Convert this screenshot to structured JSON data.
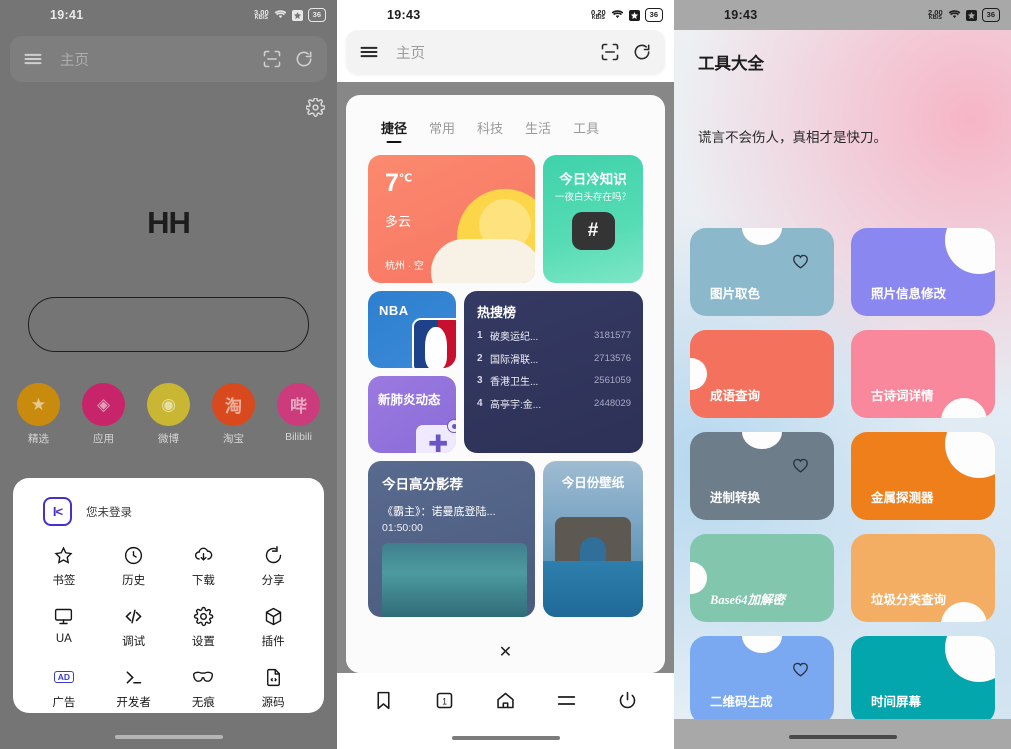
{
  "panel1": {
    "status": {
      "time": "19:41",
      "net_speed": "3.00",
      "net_unit": "KB/S",
      "battery": "36"
    },
    "omnibox": {
      "title": "主页",
      "scan_icon": "scan-icon",
      "reload_icon": "reload-icon",
      "menu_icon": "hamburger-icon"
    },
    "logo": "HH",
    "search_placeholder": "",
    "quick_links": [
      {
        "label": "精选",
        "glyph": "★",
        "color": "#c98b0e"
      },
      {
        "label": "应用",
        "glyph": "◈",
        "color": "#c7246a"
      },
      {
        "label": "微博",
        "glyph": "◉",
        "color": "#c9b734"
      },
      {
        "label": "淘宝",
        "glyph": "淘",
        "color": "#d84a1e"
      },
      {
        "label": "Bilibili",
        "glyph": "哔",
        "color": "#cc3c7c"
      }
    ],
    "sheet": {
      "account_badge": "I<",
      "account_text": "您未登录",
      "items": [
        {
          "label": "书签",
          "icon": "star-icon"
        },
        {
          "label": "历史",
          "icon": "clock-icon"
        },
        {
          "label": "下载",
          "icon": "download-cloud-icon"
        },
        {
          "label": "分享",
          "icon": "share-refresh-icon"
        },
        {
          "label": "UA",
          "icon": "monitor-icon"
        },
        {
          "label": "调试",
          "icon": "code-icon"
        },
        {
          "label": "设置",
          "icon": "gear-icon"
        },
        {
          "label": "插件",
          "icon": "cube-icon"
        },
        {
          "label": "广告",
          "icon": "ad-icon",
          "badge": "AD"
        },
        {
          "label": "开发者",
          "icon": "terminal-icon"
        },
        {
          "label": "无痕",
          "icon": "incognito-mask-icon"
        },
        {
          "label": "源码",
          "icon": "source-file-icon"
        }
      ]
    }
  },
  "panel2": {
    "status": {
      "time": "19:43",
      "net_speed": "0.20",
      "net_unit": "KB/S",
      "battery": "36"
    },
    "omnibox": {
      "title": "主页"
    },
    "tabs": [
      {
        "label": "捷径",
        "active": true
      },
      {
        "label": "常用",
        "active": false
      },
      {
        "label": "科技",
        "active": false
      },
      {
        "label": "生活",
        "active": false
      },
      {
        "label": "工具",
        "active": false
      }
    ],
    "weather": {
      "temp": "7",
      "unit": "℃",
      "desc": "多云",
      "location": "杭州 · 空"
    },
    "knowledge": {
      "title": "今日冷知识",
      "subtitle": "一夜白头存在吗？",
      "symbol": "#"
    },
    "nba": {
      "title": "NBA"
    },
    "covid": {
      "title": "新肺炎动态"
    },
    "hot": {
      "title": "热搜榜",
      "rows": [
        {
          "rank": "1",
          "keyword": "破奥运纪...",
          "count": "3181577"
        },
        {
          "rank": "2",
          "keyword": "国际滑联...",
          "count": "2713576"
        },
        {
          "rank": "3",
          "keyword": "香港卫生...",
          "count": "2561059"
        },
        {
          "rank": "4",
          "keyword": "高亭宇:金...",
          "count": "2448029"
        }
      ]
    },
    "movie": {
      "title": "今日高分影荐",
      "name": "《霸主》：诺曼底登陆...",
      "duration": "01:50:00"
    },
    "wallpaper": {
      "title": "今日份壁纸"
    },
    "close_label": "✕",
    "navbar": [
      {
        "icon": "bookmark-icon",
        "name": "bookmark"
      },
      {
        "icon": "tabs-count-icon",
        "label": "1"
      },
      {
        "icon": "home-icon",
        "name": "home"
      },
      {
        "icon": "menu-icon",
        "name": "menu"
      },
      {
        "icon": "power-icon",
        "name": "power"
      }
    ]
  },
  "panel3": {
    "status": {
      "time": "19:43",
      "net_speed": "2.00",
      "net_unit": "KB/S",
      "battery": "36"
    },
    "title": "工具大全",
    "quote": "谎言不会伤人，真相才是快刀。",
    "tools": [
      {
        "label": "图片取色",
        "color": "#8cb8cc",
        "notch": "top",
        "heart": true
      },
      {
        "label": "照片信息修改",
        "color": "#8b87f0",
        "notch": "corner",
        "heart": false
      },
      {
        "label": "成语查询",
        "color": "#f4715e",
        "notch": "left",
        "heart": false
      },
      {
        "label": "古诗词详情",
        "color": "#f9889c",
        "notch": "br",
        "heart": false
      },
      {
        "label": "进制转换",
        "color": "#6d7d89",
        "notch": "top",
        "heart": true
      },
      {
        "label": "金属探测器",
        "color": "#ef7f1a",
        "notch": "corner",
        "heart": false
      },
      {
        "label": "Base64加解密",
        "color": "#83c6ae",
        "notch": "left",
        "heart": false,
        "script": true
      },
      {
        "label": "垃圾分类查询",
        "color": "#f3ae63",
        "notch": "br",
        "heart": false
      },
      {
        "label": "二维码生成",
        "color": "#7aa9f2",
        "notch": "top",
        "heart": true
      },
      {
        "label": "时间屏幕",
        "color": "#03a6ad",
        "notch": "corner",
        "heart": false
      }
    ]
  }
}
